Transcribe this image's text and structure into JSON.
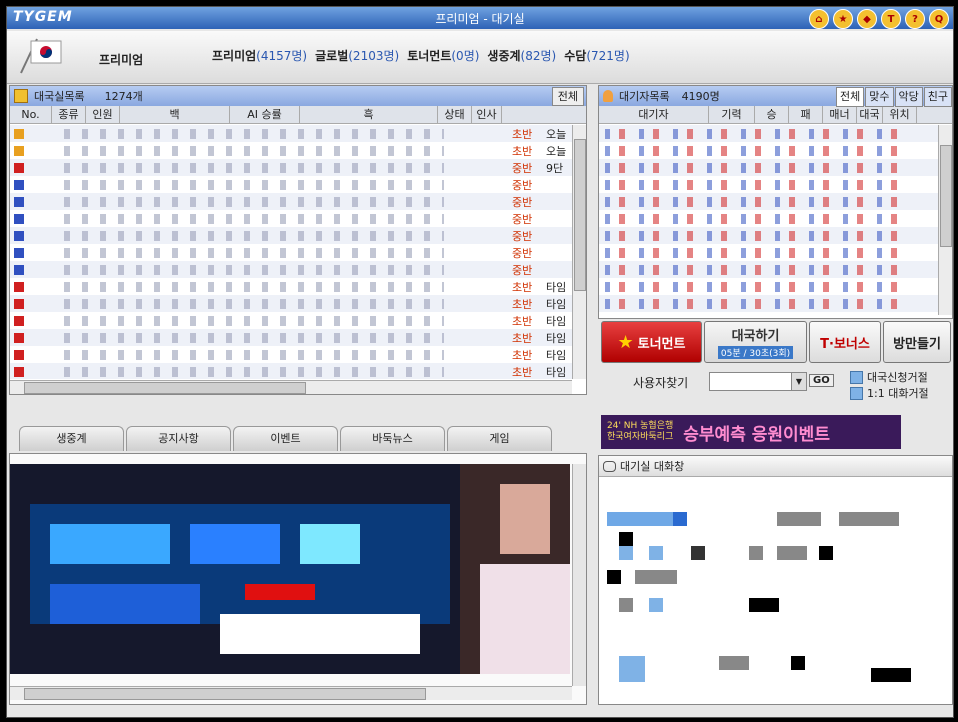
{
  "titlebar": {
    "logo": "TYGEM",
    "title": "프리미엄 - 대기실"
  },
  "top": {
    "premium_label": "프리미엄",
    "rooms": [
      {
        "name": "프리미엄",
        "count": "(4157명)"
      },
      {
        "name": "글로벌",
        "count": "(2103명)"
      },
      {
        "name": "토너먼트",
        "count": "(0명)"
      },
      {
        "name": "생중계",
        "count": "(82명)"
      },
      {
        "name": "수담",
        "count": "(721명)"
      }
    ]
  },
  "game_list": {
    "title": "대국실목록",
    "count": "1274개",
    "all_button": "전체",
    "columns": [
      "No.",
      "종류",
      "인원",
      "백",
      "AI 승률",
      "흑",
      "상태",
      "인사"
    ],
    "rows": [
      {
        "status": "초반",
        "greeting": "오늘"
      },
      {
        "status": "초반",
        "greeting": "오늘"
      },
      {
        "status": "중반",
        "greeting": "9단"
      },
      {
        "status": "중반",
        "greeting": ""
      },
      {
        "status": "중반",
        "greeting": ""
      },
      {
        "status": "중반",
        "greeting": ""
      },
      {
        "status": "중반",
        "greeting": ""
      },
      {
        "status": "중반",
        "greeting": ""
      },
      {
        "status": "중반",
        "greeting": ""
      },
      {
        "status": "초반",
        "greeting": "타임"
      },
      {
        "status": "초반",
        "greeting": "타임"
      },
      {
        "status": "초반",
        "greeting": "타임"
      },
      {
        "status": "초반",
        "greeting": "타임"
      },
      {
        "status": "초반",
        "greeting": "타임"
      },
      {
        "status": "초반",
        "greeting": "타임"
      }
    ]
  },
  "waiting_list": {
    "title": "대기자목록",
    "count": "4190명",
    "tabs": [
      "전체",
      "맞수",
      "악당",
      "친구"
    ],
    "columns": [
      "대기자",
      "기력",
      "승",
      "패",
      "매너",
      "대국",
      "위치"
    ]
  },
  "buttons": {
    "tournament": "토너먼트",
    "match": "대국하기",
    "match_sub": "05분 / 30초(3회)",
    "tbonus": "T·보너스",
    "visit": "방만들기"
  },
  "user_search": {
    "label": "사용자찾기",
    "go": "GO"
  },
  "options": {
    "refuse_match": "대국신청거절",
    "refuse_chat": "1:1 대화거절"
  },
  "bottom_tabs": [
    "생중계",
    "공지사항",
    "이벤트",
    "바둑뉴스",
    "게임"
  ],
  "event_banner": {
    "line1": "24' NH 농협은행",
    "line2": "한국여자바둑리그",
    "main": "승부예측 응원이벤트"
  },
  "chat": {
    "title": "대기실 대화창"
  },
  "colors": {
    "accent": "#2a57b0",
    "status": "#d03000"
  }
}
